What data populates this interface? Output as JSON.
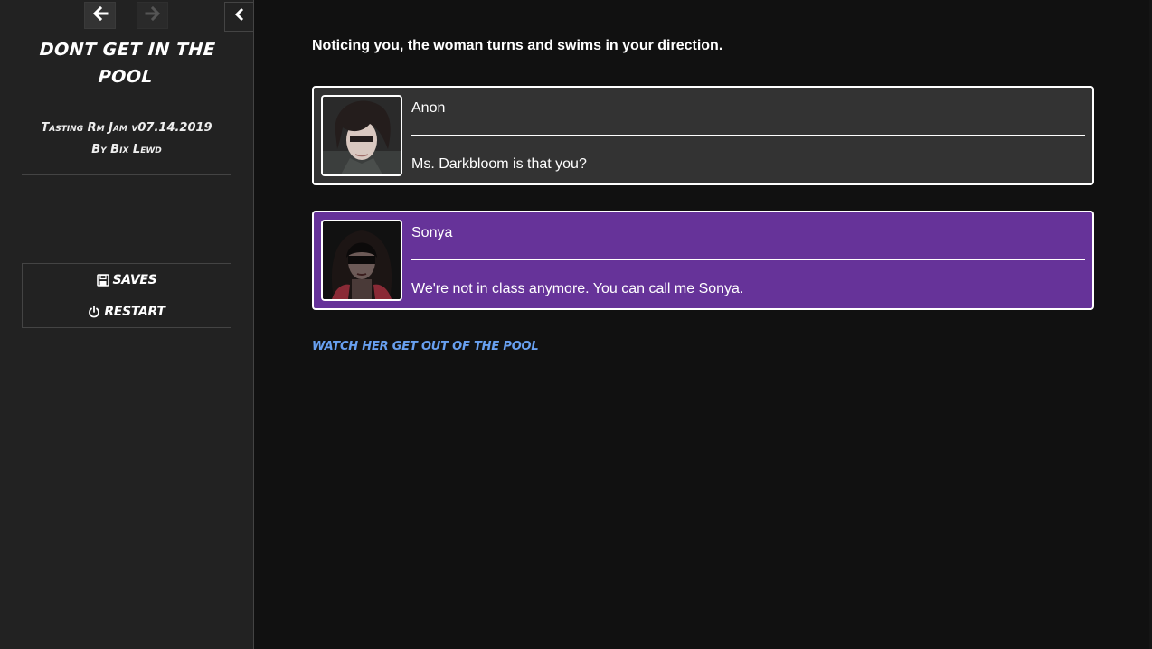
{
  "sidebar": {
    "title": "Dont Get In The Pool",
    "subtitle_line1": "Tasting Rm Jam v07.14.2019",
    "subtitle_line2": "By Bix Lewd",
    "menu": {
      "saves_label": "Saves",
      "restart_label": "Restart"
    }
  },
  "passage": {
    "narration": "Noticing you, the woman turns and swims in your direction.",
    "dialogue": [
      {
        "speaker": "Anon",
        "text": "Ms. Darkbloom is that you?",
        "color": "#333333"
      },
      {
        "speaker": "Sonya",
        "text": "We're not in class anymore. You can call me Sonya.",
        "color": "#663399"
      }
    ],
    "link_label": "Watch her get out of the pool"
  },
  "icons": {
    "back": "arrow-left-icon",
    "forward": "arrow-right-icon",
    "toggle": "chevron-left-icon",
    "saves": "floppy-disk-icon",
    "restart": "power-icon"
  },
  "colors": {
    "sidebar_bg": "#222222",
    "page_bg": "#111111",
    "link": "#68a0f0",
    "sonya_box": "#663399",
    "anon_box": "#333333"
  }
}
